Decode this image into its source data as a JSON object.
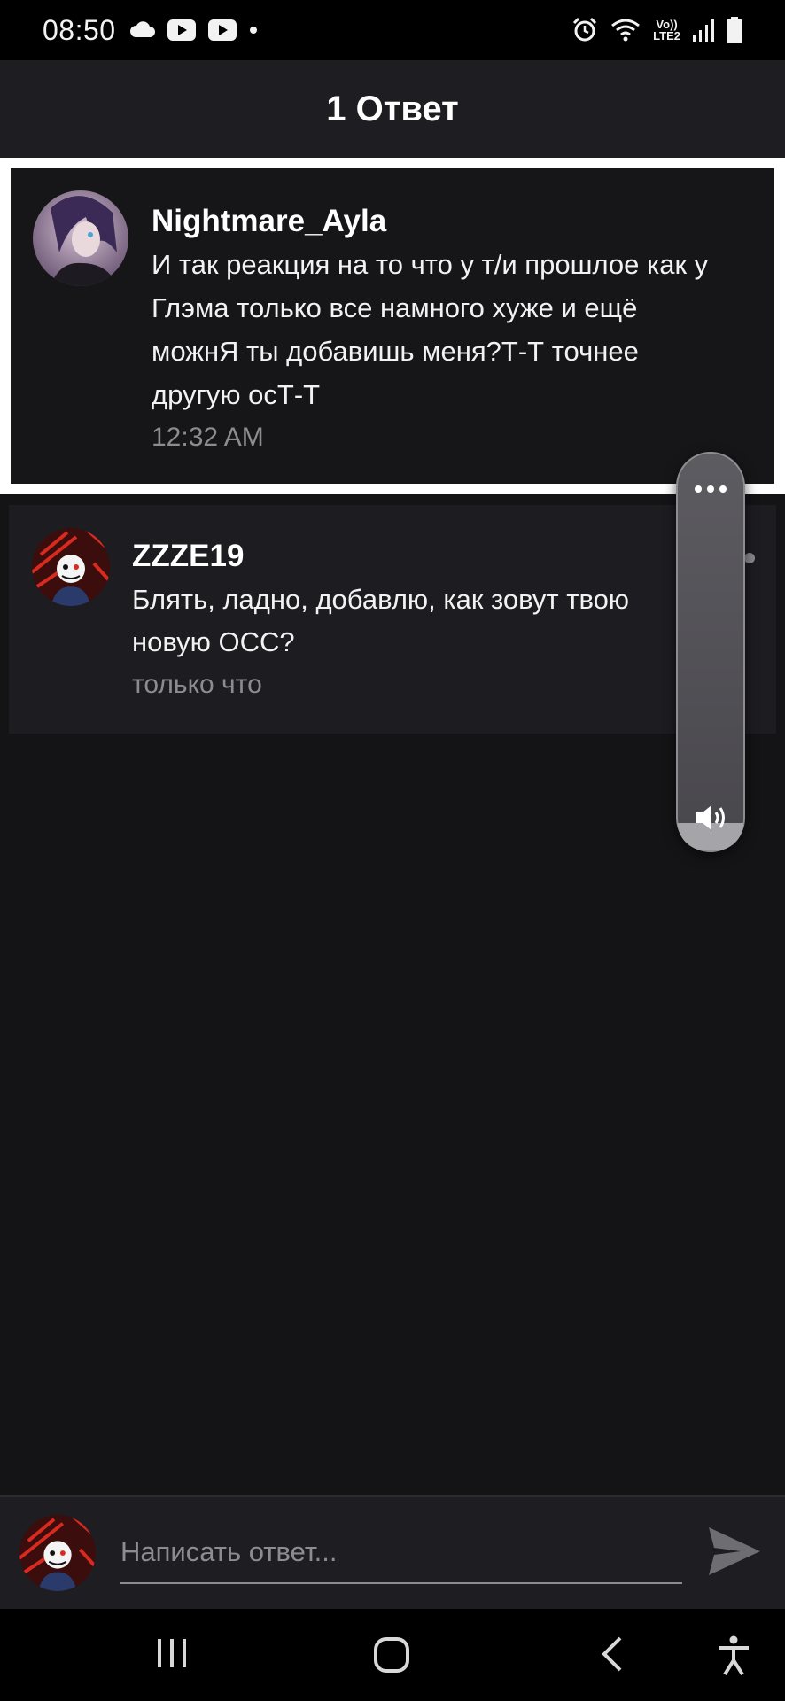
{
  "status_bar": {
    "time": "08:50",
    "icons": [
      "cloud-icon",
      "youtube-icon",
      "youtube-icon",
      "dot-icon",
      "alarm-icon",
      "wifi-icon",
      "volte-icon",
      "signal-icon",
      "battery-icon"
    ],
    "volte_top": "Vo))",
    "volte_bottom": "LTE2"
  },
  "header": {
    "title": "1 Ответ"
  },
  "parent_comment": {
    "author": "Nightmare_Ayla",
    "lines": [
      "И так реакция на то что у т/и прошлое как у",
      "Глэма только все намного хуже и ещё",
      "можнЯ ты добавишь меня?Т-Т точнее",
      "другую осТ-Т"
    ],
    "time": "12:32 AM"
  },
  "reply": {
    "author": "ZZZE19",
    "lines": [
      "Блять, ладно, добавлю, как зовут твою",
      "новую ОСС?"
    ],
    "time": "только что"
  },
  "volume_panel": {
    "icons": [
      "more-icon",
      "speaker-icon"
    ],
    "level": 0.07
  },
  "reply_input": {
    "placeholder": "Написать ответ..."
  },
  "nav_bar": {
    "icons": [
      "recent-apps-icon",
      "home-icon",
      "back-icon",
      "accessibility-icon"
    ]
  },
  "colors": {
    "background": "#141316",
    "header": "#1e1d21",
    "highlight_border": "#ffffff",
    "muted_text": "#8c8b90"
  }
}
